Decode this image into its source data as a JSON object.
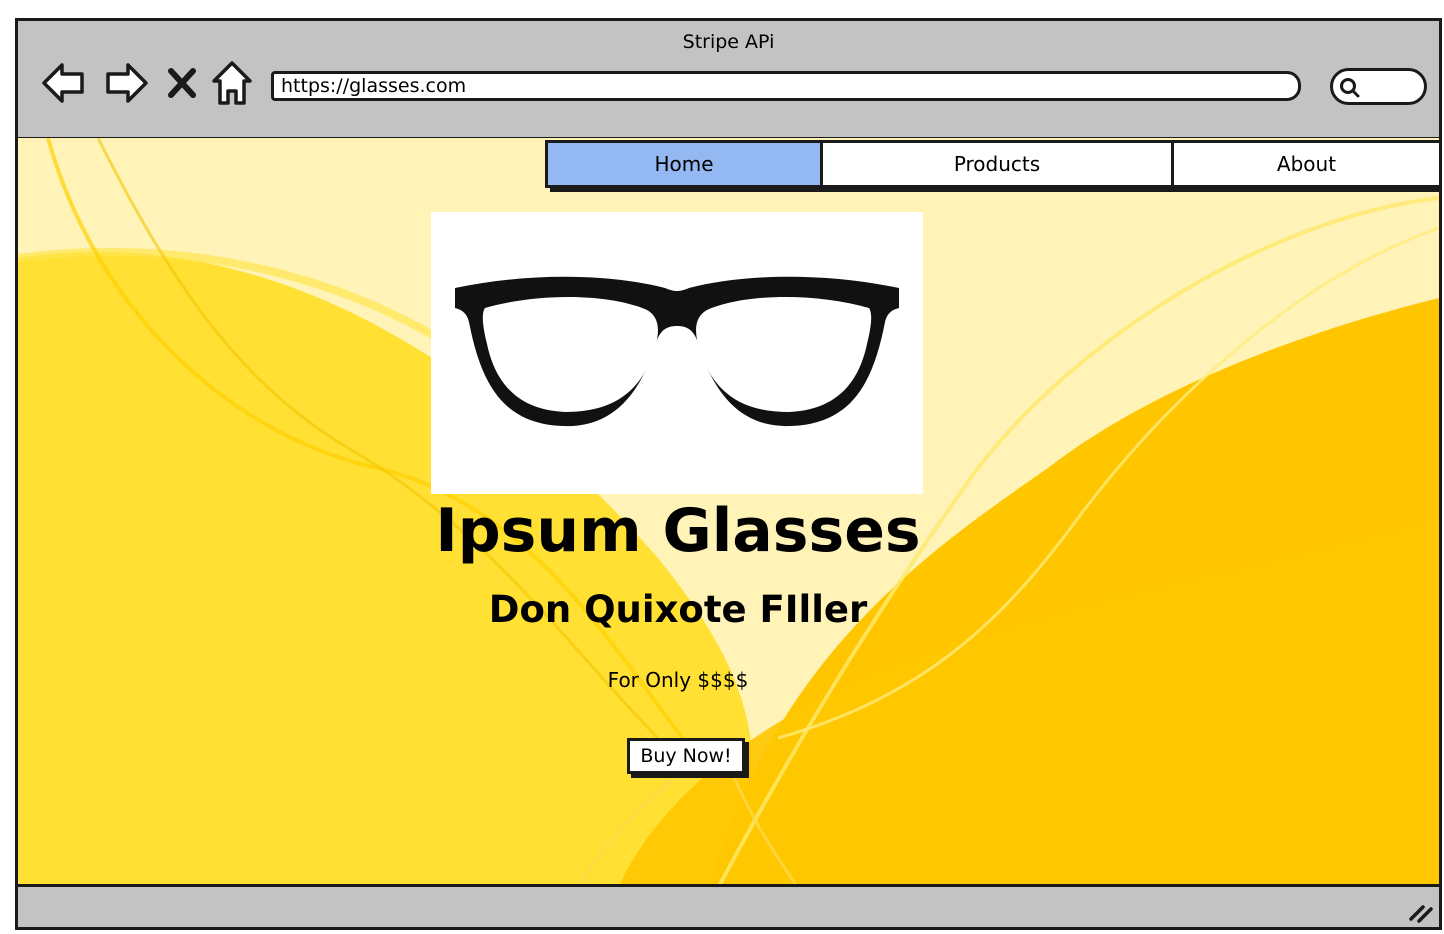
{
  "window": {
    "title": "Stripe APi"
  },
  "toolbar": {
    "back_icon": "arrow-left-icon",
    "forward_icon": "arrow-right-icon",
    "stop_icon": "close-icon",
    "home_icon": "home-icon",
    "url": "https://glasses.com",
    "search_icon": "search-icon"
  },
  "nav": {
    "tabs": [
      {
        "label": "Home",
        "active": true
      },
      {
        "label": "Products",
        "active": false
      },
      {
        "label": "About",
        "active": false
      }
    ]
  },
  "product": {
    "image": "glasses-image",
    "title": "Ipsum Glasses",
    "subtitle": "Don Quixote FIller",
    "price": "For Only $$$$",
    "buy_label": "Buy Now!"
  },
  "colors": {
    "chrome": "#c3c3c3",
    "active_tab": "#94b9f2",
    "background_light": "#fff3b8",
    "background_yellow": "#ffe033",
    "background_gold": "#ffc600"
  }
}
